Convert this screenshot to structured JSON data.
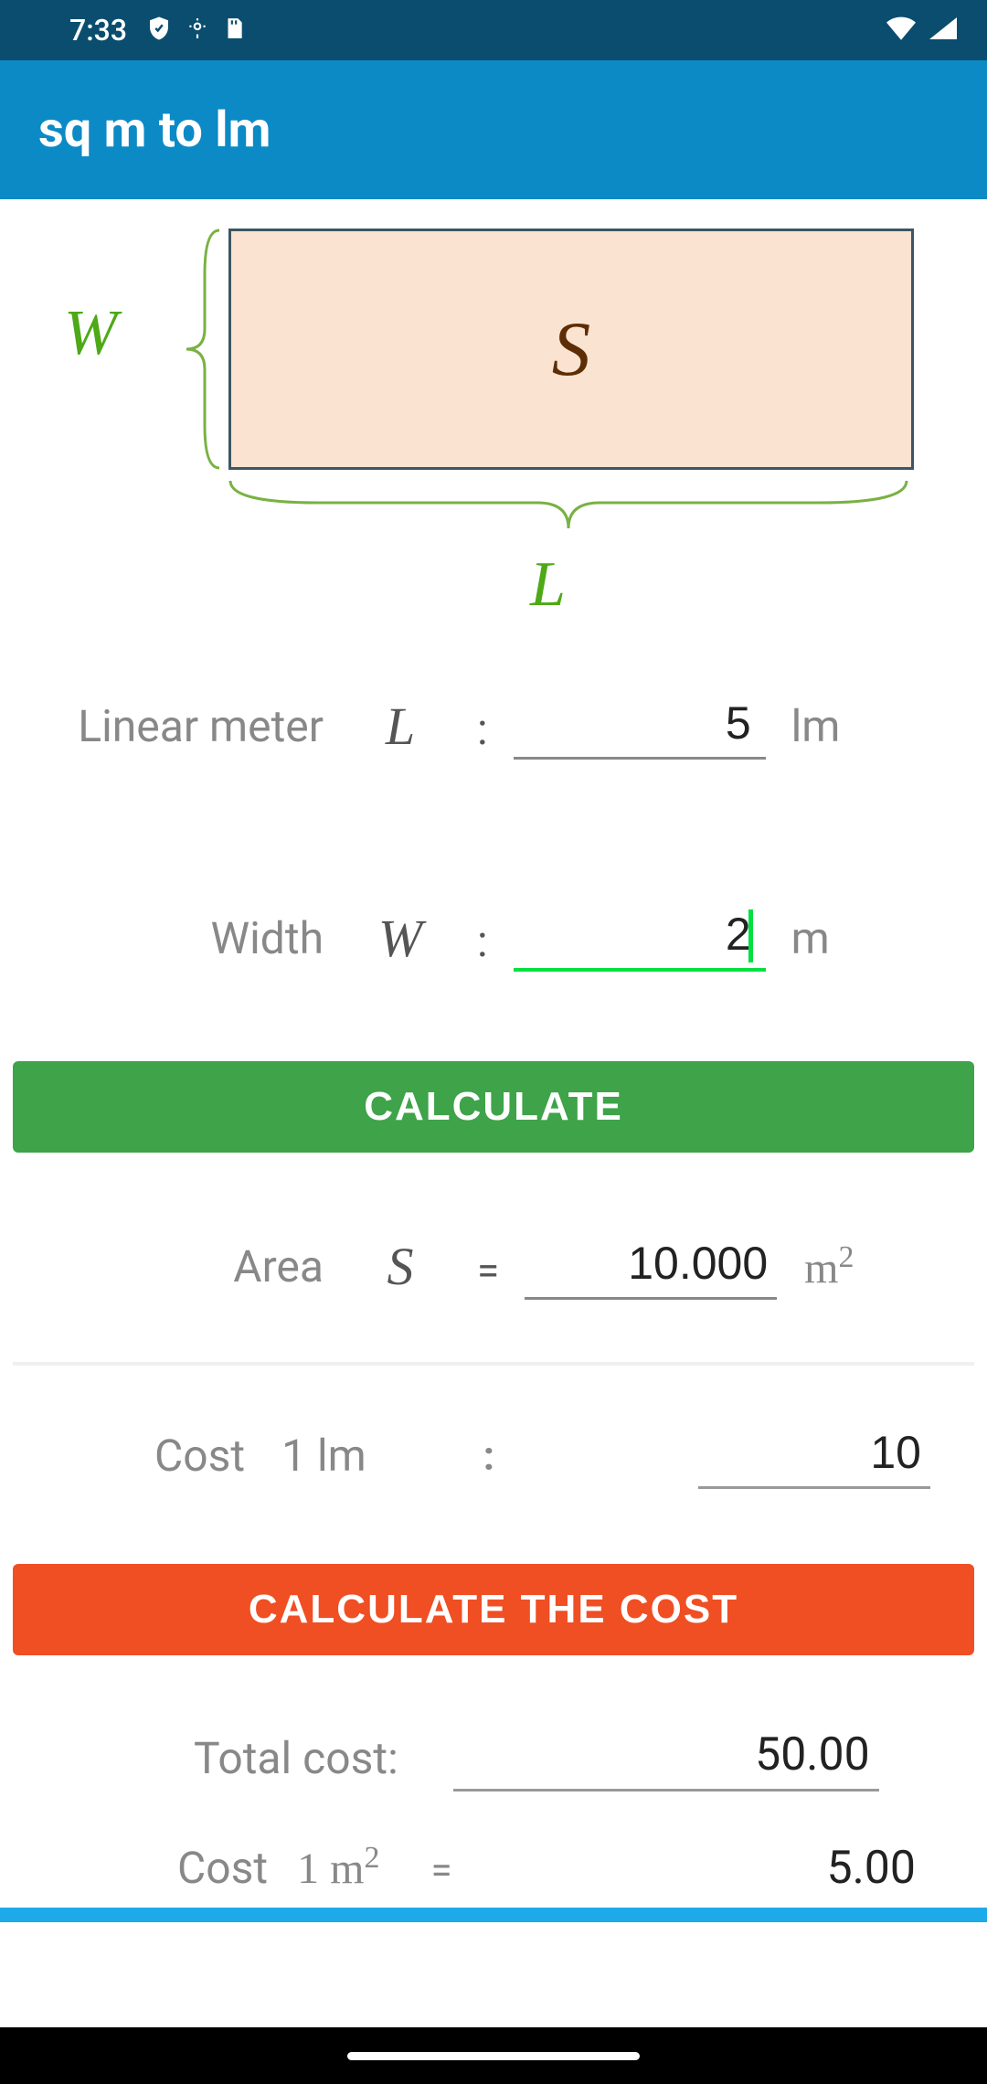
{
  "status": {
    "time": "7:33"
  },
  "header": {
    "title": "sq m to lm"
  },
  "diagram": {
    "w": "W",
    "l": "L",
    "s": "S"
  },
  "inputs": {
    "lm_label": "Linear meter",
    "lm_symbol": "L",
    "lm_value": "5",
    "lm_unit": "lm",
    "w_label": "Width",
    "w_symbol": "W",
    "w_value": "2",
    "w_unit": "m"
  },
  "buttons": {
    "calculate": "CALCULATE",
    "calculate_cost": "CALCULATE THE COST"
  },
  "area": {
    "label": "Area",
    "symbol": "S",
    "value": "10.000",
    "unit_base": "m",
    "unit_exp": "2"
  },
  "cost": {
    "label": "Cost",
    "unit": "1 lm",
    "sep": ":",
    "value": "10"
  },
  "total": {
    "label": "Total cost:",
    "value": "50.00"
  },
  "cpm": {
    "label": "Cost",
    "unit_base": "1 m",
    "unit_exp": "2",
    "eq": "=",
    "value": "5.00"
  },
  "colors": {
    "primary": "#0c8ac6",
    "status": "#0a4d6e",
    "green": "#3ea349",
    "orange": "#f04e23",
    "accent": "#1ea9e9",
    "dim_green": "#4da916",
    "s_color": "#5d2d05"
  }
}
